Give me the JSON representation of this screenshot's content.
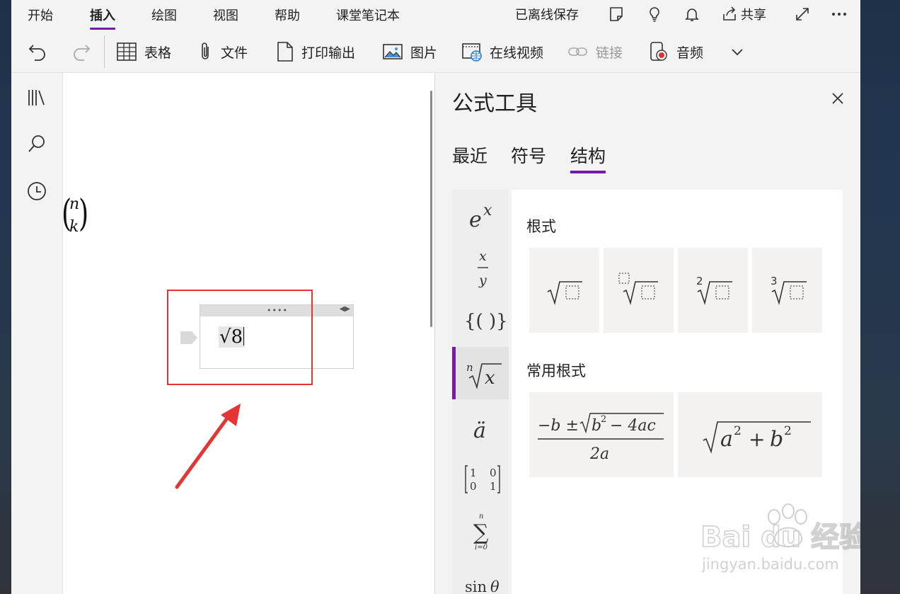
{
  "menu_tabs": [
    "开始",
    "插入",
    "绘图",
    "视图",
    "帮助",
    "课堂笔记本"
  ],
  "active_menu_tab": "插入",
  "status": {
    "saved_offline": "已离线保存",
    "share": "共享"
  },
  "toolbar": {
    "table": "表格",
    "file": "文件",
    "printout": "打印输出",
    "picture": "图片",
    "online_video": "在线视频",
    "link": "链接",
    "audio": "音频"
  },
  "canvas": {
    "binom_top": "n",
    "binom_bottom": "k",
    "equation_text": "√8"
  },
  "pane": {
    "title": "公式工具",
    "tabs": [
      "最近",
      "符号",
      "结构"
    ],
    "active_tab": "结构",
    "categories": [
      "e^x",
      "x/y",
      "{()}",
      "ⁿ√x",
      "ä",
      "[1 0; 0 1]",
      "Σ i=0..n",
      "sin θ"
    ],
    "active_category": "ⁿ√x",
    "sections": {
      "radicals_title": "根式",
      "common_radicals_title": "常用根式"
    },
    "radicals": [
      "√□",
      "□√□",
      "²√□",
      "³√□"
    ],
    "common_radicals": [
      "(−b ± √(b² − 4ac)) / 2a",
      "√(a² + b²)"
    ]
  },
  "watermark": {
    "brand": "Bai du 经验",
    "url": "jingyan.baidu.com"
  },
  "colors": {
    "accent": "#7719aa",
    "highlight": "#e53434"
  }
}
